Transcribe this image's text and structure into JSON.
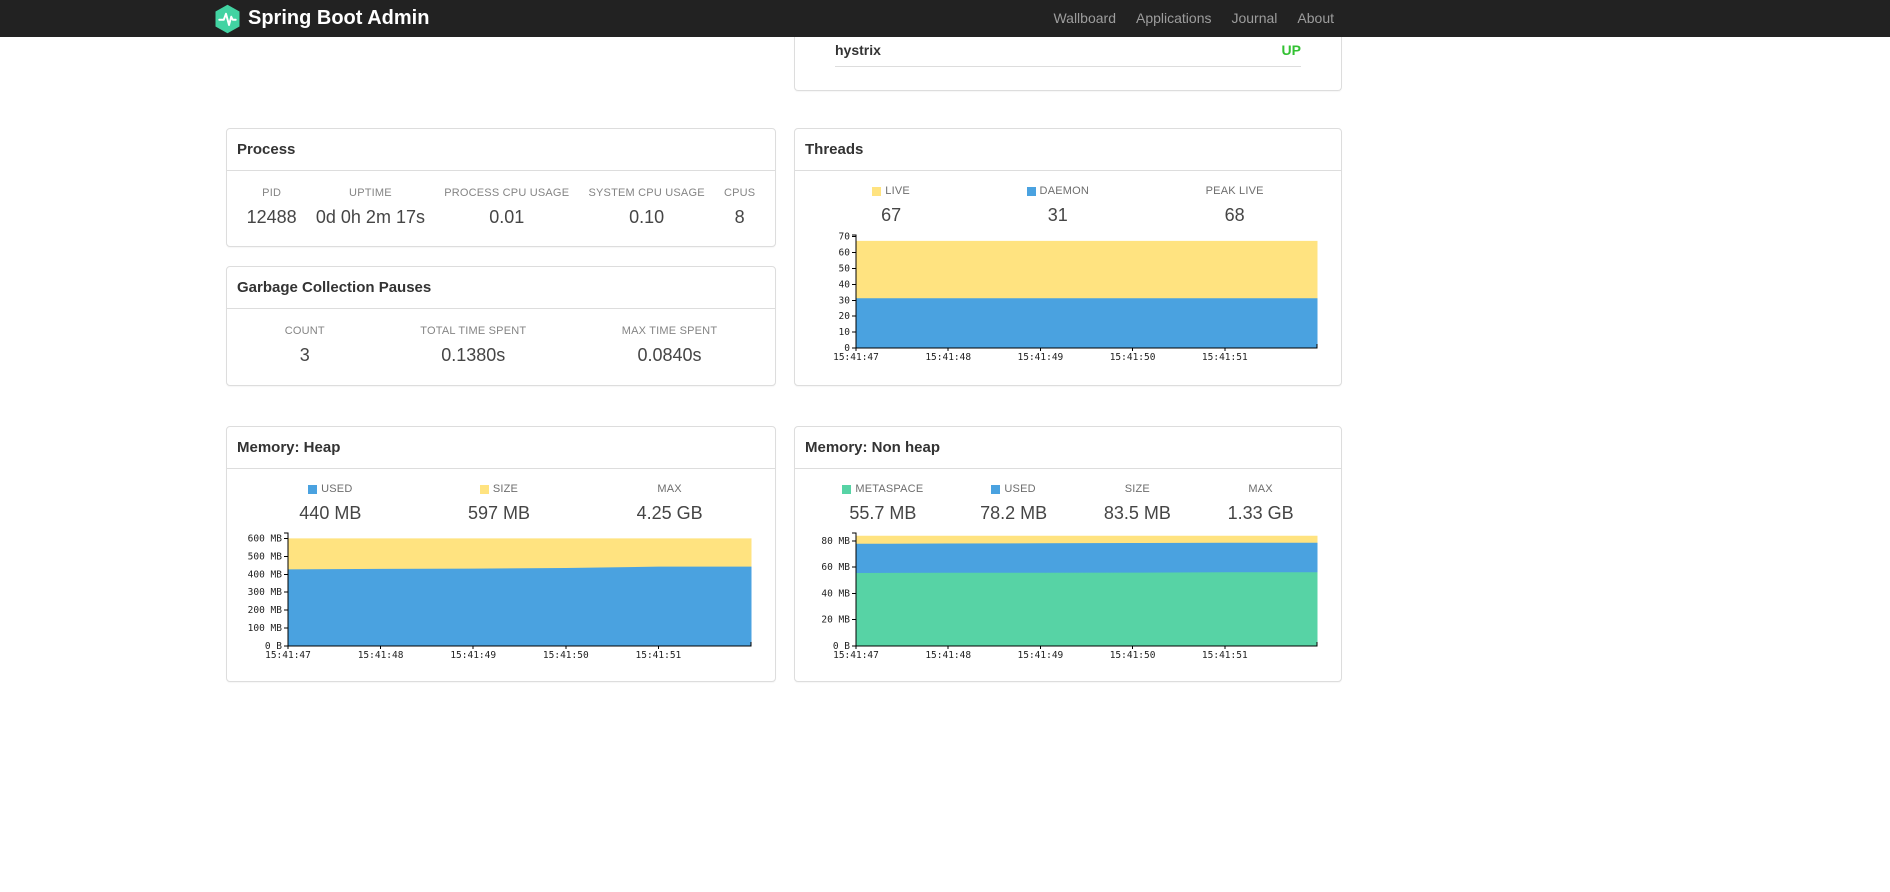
{
  "navbar": {
    "brand": "Spring Boot Admin",
    "links": [
      {
        "label": "Wallboard"
      },
      {
        "label": "Applications"
      },
      {
        "label": "Journal"
      },
      {
        "label": "About"
      }
    ]
  },
  "colors": {
    "brand_logo_green": "#42d3a2",
    "status_up_green": "#32c132",
    "chart_yellow": "#ffe380",
    "chart_blue": "#4aa2e0",
    "chart_green": "#57d3a5",
    "navbar_bg": "#222222"
  },
  "health": {
    "service": "hystrix",
    "status": "UP"
  },
  "process": {
    "title": "Process",
    "stats": [
      {
        "label": "PID",
        "value": "12488"
      },
      {
        "label": "UPTIME",
        "value": "0d 0h 2m 17s"
      },
      {
        "label": "PROCESS CPU USAGE",
        "value": "0.01"
      },
      {
        "label": "SYSTEM CPU USAGE",
        "value": "0.10"
      },
      {
        "label": "CPUS",
        "value": "8"
      }
    ]
  },
  "gc": {
    "title": "Garbage Collection Pauses",
    "stats": [
      {
        "label": "COUNT",
        "value": "3"
      },
      {
        "label": "TOTAL TIME SPENT",
        "value": "0.1380s"
      },
      {
        "label": "MAX TIME SPENT",
        "value": "0.0840s"
      }
    ]
  },
  "threads": {
    "title": "Threads",
    "legend": [
      {
        "label": "LIVE",
        "value": "67",
        "color": "#ffe380"
      },
      {
        "label": "DAEMON",
        "value": "31",
        "color": "#4aa2e0"
      },
      {
        "label": "PEAK LIVE",
        "value": "68",
        "color": null
      }
    ]
  },
  "memory_heap": {
    "title": "Memory: Heap",
    "legend": [
      {
        "label": "USED",
        "value": "440 MB",
        "color": "#4aa2e0"
      },
      {
        "label": "SIZE",
        "value": "597 MB",
        "color": "#ffe380"
      },
      {
        "label": "MAX",
        "value": "4.25 GB",
        "color": null
      }
    ]
  },
  "memory_nonheap": {
    "title": "Memory: Non heap",
    "legend": [
      {
        "label": "METASPACE",
        "value": "55.7 MB",
        "color": "#57d3a5"
      },
      {
        "label": "USED",
        "value": "78.2 MB",
        "color": "#4aa2e0"
      },
      {
        "label": "SIZE",
        "value": "83.5 MB",
        "color": null
      },
      {
        "label": "MAX",
        "value": "1.33 GB",
        "color": null
      }
    ]
  },
  "chart_data": [
    {
      "id": "threads",
      "type": "area",
      "title": "Threads",
      "x": [
        "15:41:47",
        "15:41:48",
        "15:41:49",
        "15:41:50",
        "15:41:51",
        ""
      ],
      "ylim": [
        0,
        71
      ],
      "yticks": [
        0,
        10,
        20,
        30,
        40,
        50,
        60,
        70
      ],
      "ytick_labels": [
        "0",
        "10",
        "20",
        "30",
        "40",
        "50",
        "60",
        "70"
      ],
      "legend_position": "top",
      "grid": false,
      "series": [
        {
          "name": "LIVE",
          "color": "#ffe380",
          "values": [
            67,
            67,
            67,
            67,
            67,
            67
          ]
        },
        {
          "name": "DAEMON",
          "color": "#4aa2e0",
          "values": [
            31,
            31,
            31,
            31,
            31,
            31
          ]
        }
      ]
    },
    {
      "id": "memory-heap",
      "type": "area",
      "title": "Memory: Heap",
      "unit": "MB",
      "x": [
        "15:41:47",
        "15:41:48",
        "15:41:49",
        "15:41:50",
        "15:41:51",
        ""
      ],
      "ylim": [
        0,
        630
      ],
      "yticks": [
        0,
        100,
        200,
        300,
        400,
        500,
        600
      ],
      "ytick_labels": [
        "0 B",
        "100 MB",
        "200 MB",
        "300 MB",
        "400 MB",
        "500 MB",
        "600 MB"
      ],
      "legend_position": "top",
      "grid": false,
      "series": [
        {
          "name": "SIZE",
          "color": "#ffe380",
          "values": [
            597,
            597,
            597,
            597,
            597,
            597
          ]
        },
        {
          "name": "USED",
          "color": "#4aa2e0",
          "values": [
            424,
            427,
            429,
            432,
            440,
            440
          ]
        }
      ]
    },
    {
      "id": "memory-nonheap",
      "type": "area",
      "title": "Memory: Non heap",
      "unit": "MB",
      "x": [
        "15:41:47",
        "15:41:48",
        "15:41:49",
        "15:41:50",
        "15:41:51",
        ""
      ],
      "ylim": [
        0,
        86
      ],
      "yticks": [
        0,
        20,
        40,
        60,
        80
      ],
      "ytick_labels": [
        "0 B",
        "20 MB",
        "40 MB",
        "60 MB",
        "80 MB"
      ],
      "legend_position": "top",
      "grid": false,
      "series": [
        {
          "name": "SIZE",
          "color": "#ffe380",
          "values": [
            83.5,
            83.5,
            83.5,
            83.5,
            83.5,
            83.5
          ]
        },
        {
          "name": "USED",
          "color": "#4aa2e0",
          "values": [
            77.4,
            77.6,
            77.8,
            78.0,
            78.2,
            78.2
          ]
        },
        {
          "name": "METASPACE",
          "color": "#57d3a5",
          "values": [
            55.2,
            55.3,
            55.4,
            55.5,
            55.7,
            55.7
          ]
        }
      ]
    }
  ]
}
